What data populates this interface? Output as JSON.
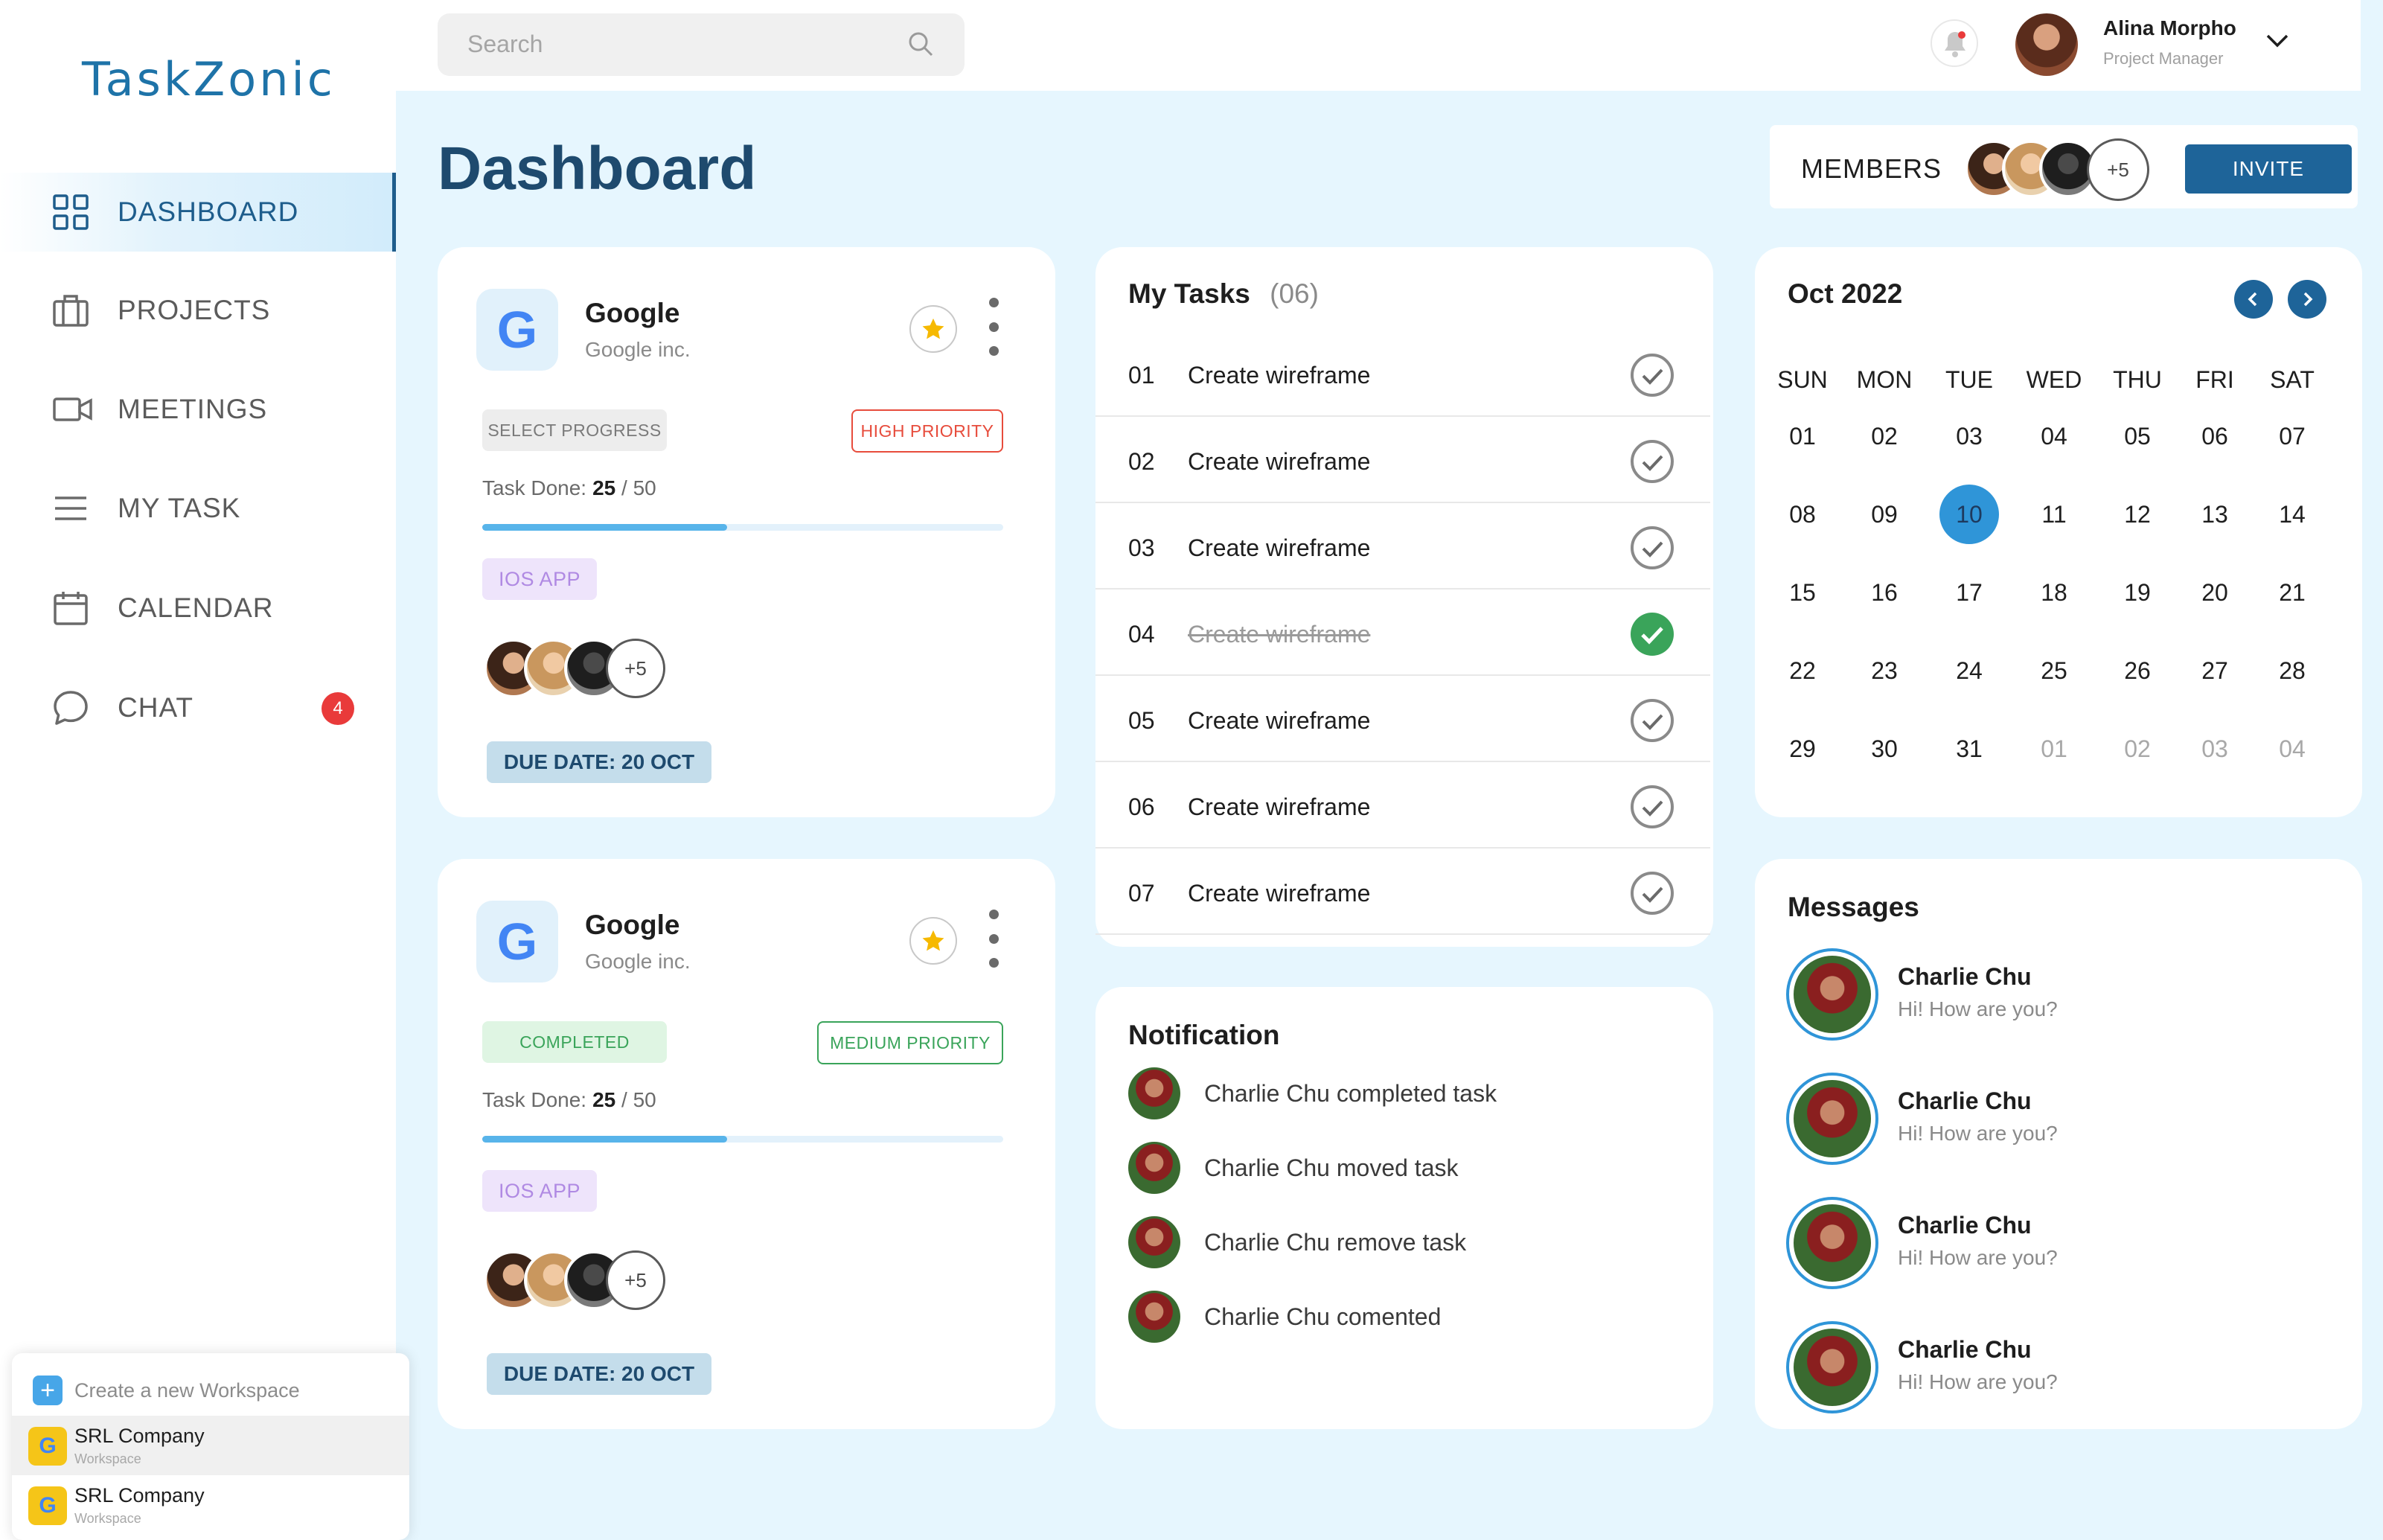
{
  "app": {
    "logo": "TaskZonic"
  },
  "sidebar": {
    "items": [
      {
        "label": "DASHBOARD",
        "icon": "grid-icon",
        "active": true
      },
      {
        "label": "PROJECTS",
        "icon": "briefcase-icon"
      },
      {
        "label": "MEETINGS",
        "icon": "video-icon"
      },
      {
        "label": "MY TASK",
        "icon": "menu-icon"
      },
      {
        "label": "CALENDAR",
        "icon": "calendar-icon"
      },
      {
        "label": "CHAT",
        "icon": "chat-icon",
        "badge": "4"
      }
    ]
  },
  "workspace": {
    "create_label": "Create a new Workspace",
    "items": [
      {
        "name": "SRL Company",
        "sub": "Workspace",
        "logo": "G"
      },
      {
        "name": "SRL Company",
        "sub": "Workspace",
        "logo": "G"
      }
    ]
  },
  "header": {
    "search_placeholder": "Search",
    "user": {
      "name": "Alina Morpho",
      "role": "Project Manager"
    }
  },
  "page": {
    "title": "Dashboard"
  },
  "members": {
    "label": "MEMBERS",
    "more": "+5",
    "invite_label": "INVITE"
  },
  "projects": [
    {
      "name": "Google",
      "company": "Google inc.",
      "status": "SELECT PROGRESS",
      "priority": "HIGH PRIORITY",
      "task_done_label": "Task Done:",
      "done": "25",
      "total": "/ 50",
      "progress": 0.47,
      "tag": "IOS APP",
      "more_members": "+5",
      "due": "DUE DATE: 20 OCT"
    },
    {
      "name": "Google",
      "company": "Google inc.",
      "status": "COMPLETED",
      "priority": "MEDIUM PRIORITY",
      "task_done_label": "Task Done:",
      "done": "25",
      "total": "/ 50",
      "progress": 0.47,
      "tag": "IOS APP",
      "more_members": "+5",
      "due": "DUE DATE: 20 OCT"
    }
  ],
  "tasks": {
    "title": "My Tasks",
    "count": "(06)",
    "items": [
      {
        "num": "01",
        "text": "Create wireframe",
        "done": false
      },
      {
        "num": "02",
        "text": "Create wireframe",
        "done": false
      },
      {
        "num": "03",
        "text": "Create wireframe",
        "done": false
      },
      {
        "num": "04",
        "text": "Create wireframe",
        "done": true
      },
      {
        "num": "05",
        "text": "Create wireframe",
        "done": false
      },
      {
        "num": "06",
        "text": "Create wireframe",
        "done": false
      },
      {
        "num": "07",
        "text": "Create wireframe",
        "done": false
      }
    ]
  },
  "calendar": {
    "month": "Oct 2022",
    "dows": [
      "SUN",
      "MON",
      "TUE",
      "WED",
      "THU",
      "FRI",
      "SAT"
    ],
    "weeks": [
      [
        "01",
        "02",
        "03",
        "04",
        "05",
        "06",
        "07"
      ],
      [
        "08",
        "09",
        "10",
        "11",
        "12",
        "13",
        "14"
      ],
      [
        "15",
        "16",
        "17",
        "18",
        "19",
        "20",
        "21"
      ],
      [
        "22",
        "23",
        "24",
        "25",
        "26",
        "27",
        "28"
      ],
      [
        "29",
        "30",
        "31",
        "01",
        "02",
        "03",
        "04"
      ]
    ],
    "today": "10"
  },
  "notifications": {
    "title": "Notification",
    "items": [
      "Charlie Chu completed task",
      "Charlie Chu moved task",
      "Charlie Chu remove task",
      "Charlie Chu comented"
    ]
  },
  "messages": {
    "title": "Messages",
    "items": [
      {
        "name": "Charlie Chu",
        "text": "Hi! How are you?"
      },
      {
        "name": "Charlie Chu",
        "text": "Hi! How are you?"
      },
      {
        "name": "Charlie Chu",
        "text": "Hi! How are you?"
      },
      {
        "name": "Charlie Chu",
        "text": "Hi! How are you?"
      }
    ]
  },
  "colors": {
    "accent": "#1e6499",
    "sidebar_active": "#1e5d8c",
    "today": "#2f95d8",
    "badge": "#e93a3a",
    "high_priority": "#e74c3c",
    "medium_priority": "#3aa45a"
  }
}
